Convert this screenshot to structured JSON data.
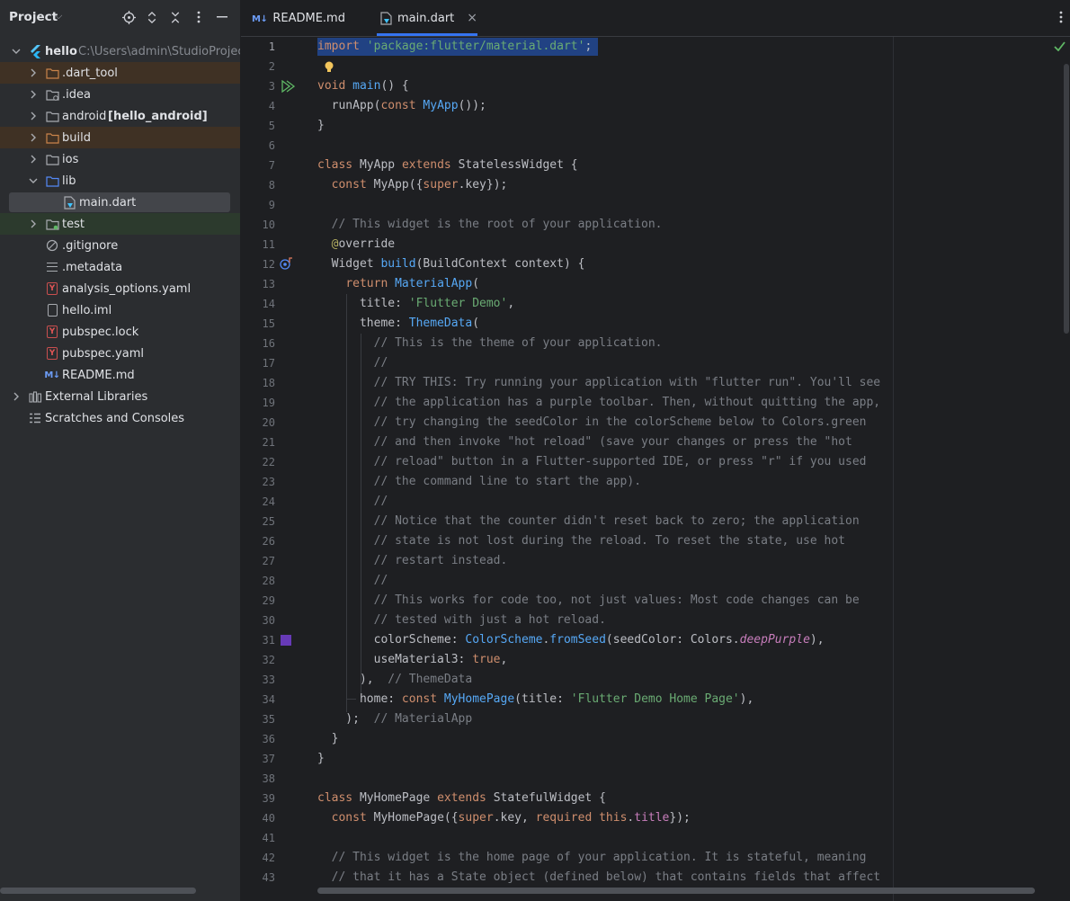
{
  "project_panel": {
    "title": "Project",
    "header_icons": [
      "locate-icon",
      "expand-all-icon",
      "collapse-all-icon",
      "more-icon",
      "minimize-icon"
    ],
    "tree": [
      {
        "name": "hello",
        "hint": "C:\\Users\\admin\\StudioProjec",
        "kind": "module",
        "depth": 0,
        "expanded": true
      },
      {
        "name": ".dart_tool",
        "kind": "folder",
        "depth": 1,
        "excluded": true
      },
      {
        "name": ".idea",
        "kind": "folder",
        "depth": 1
      },
      {
        "name": "android",
        "bold_suffix": "[hello_android]",
        "kind": "folder",
        "depth": 1
      },
      {
        "name": "build",
        "kind": "folder",
        "depth": 1,
        "excluded": true
      },
      {
        "name": "ios",
        "kind": "folder",
        "depth": 1
      },
      {
        "name": "lib",
        "kind": "folder-source",
        "depth": 1,
        "expanded": true
      },
      {
        "name": "main.dart",
        "kind": "dart-file",
        "depth": 2,
        "selected": true
      },
      {
        "name": "test",
        "kind": "folder-test",
        "depth": 1
      },
      {
        "name": ".gitignore",
        "kind": "ignore-file",
        "depth": 1
      },
      {
        "name": ".metadata",
        "kind": "text-file",
        "depth": 1
      },
      {
        "name": "analysis_options.yaml",
        "kind": "yaml-file",
        "depth": 1
      },
      {
        "name": "hello.iml",
        "kind": "iml-file",
        "depth": 1
      },
      {
        "name": "pubspec.lock",
        "kind": "yaml-file",
        "depth": 1
      },
      {
        "name": "pubspec.yaml",
        "kind": "yaml-file",
        "depth": 1
      },
      {
        "name": "README.md",
        "kind": "md-file",
        "depth": 1
      },
      {
        "name": "External Libraries",
        "kind": "libraries",
        "depth": 0
      },
      {
        "name": "Scratches and Consoles",
        "kind": "scratches",
        "depth": 0
      }
    ]
  },
  "tabs": [
    {
      "label": "README.md",
      "icon": "markdown-icon",
      "active": false
    },
    {
      "label": "main.dart",
      "icon": "dart-file-icon",
      "active": true,
      "close": "×"
    }
  ],
  "editor": {
    "line_numbers": [
      "1",
      "2",
      "3",
      "4",
      "5",
      "6",
      "7",
      "8",
      "9",
      "10",
      "11",
      "12",
      "13",
      "14",
      "15",
      "16",
      "17",
      "18",
      "19",
      "20",
      "21",
      "22",
      "23",
      "24",
      "25",
      "26",
      "27",
      "28",
      "29",
      "30",
      "31",
      "32",
      "33",
      "34",
      "35",
      "36",
      "37",
      "38",
      "39",
      "40",
      "41",
      "42",
      "43"
    ],
    "lines": [
      [
        [
          "kw",
          "import "
        ],
        [
          "str",
          "'package:flutter/material.dart'"
        ],
        [
          "",
          "; "
        ]
      ],
      [],
      [
        [
          "kw",
          "void "
        ],
        [
          "fn",
          "main"
        ],
        [
          "",
          "() {"
        ]
      ],
      [
        [
          "",
          "  runApp("
        ],
        [
          "kw",
          "const "
        ],
        [
          "cls",
          "MyApp"
        ],
        [
          "",
          "());"
        ]
      ],
      [
        [
          "",
          "}"
        ]
      ],
      [],
      [
        [
          "kw",
          "class "
        ],
        [
          "",
          "MyApp "
        ],
        [
          "kw",
          "extends "
        ],
        [
          "",
          "StatelessWidget {"
        ]
      ],
      [
        [
          "",
          "  "
        ],
        [
          "kw",
          "const "
        ],
        [
          "",
          "MyApp({"
        ],
        [
          "kw",
          "super"
        ],
        [
          "",
          ".key});"
        ]
      ],
      [],
      [
        [
          "cm",
          "  // This widget is the root of your application."
        ]
      ],
      [
        [
          "ann",
          "  @"
        ],
        [
          "",
          "override"
        ]
      ],
      [
        [
          "",
          "  Widget "
        ],
        [
          "fn",
          "build"
        ],
        [
          "",
          "(BuildContext context) {"
        ]
      ],
      [
        [
          "",
          "    "
        ],
        [
          "kw",
          "return "
        ],
        [
          "cls",
          "MaterialApp"
        ],
        [
          "",
          "("
        ]
      ],
      [
        [
          "",
          "      title: "
        ],
        [
          "str",
          "'Flutter Demo'"
        ],
        [
          "",
          ","
        ]
      ],
      [
        [
          "",
          "      theme: "
        ],
        [
          "cls",
          "ThemeData"
        ],
        [
          "",
          "("
        ]
      ],
      [
        [
          "cm",
          "        // This is the theme of your application."
        ]
      ],
      [
        [
          "cm",
          "        //"
        ]
      ],
      [
        [
          "cm",
          "        // TRY THIS: Try running your application with \"flutter run\". You'll see"
        ]
      ],
      [
        [
          "cm",
          "        // the application has a purple toolbar. Then, without quitting the app,"
        ]
      ],
      [
        [
          "cm",
          "        // try changing the seedColor in the colorScheme below to Colors.green"
        ]
      ],
      [
        [
          "cm",
          "        // and then invoke \"hot reload\" (save your changes or press the \"hot"
        ]
      ],
      [
        [
          "cm",
          "        // reload\" button in a Flutter-supported IDE, or press \"r\" if you used"
        ]
      ],
      [
        [
          "cm",
          "        // the command line to start the app)."
        ]
      ],
      [
        [
          "cm",
          "        //"
        ]
      ],
      [
        [
          "cm",
          "        // Notice that the counter didn't reset back to zero; the application"
        ]
      ],
      [
        [
          "cm",
          "        // state is not lost during the reload. To reset the state, use hot"
        ]
      ],
      [
        [
          "cm",
          "        // restart instead."
        ]
      ],
      [
        [
          "cm",
          "        //"
        ]
      ],
      [
        [
          "cm",
          "        // This works for code too, not just values: Most code changes can be"
        ]
      ],
      [
        [
          "cm",
          "        // tested with just a hot reload."
        ]
      ],
      [
        [
          "",
          "        colorScheme: "
        ],
        [
          "cls",
          "ColorScheme"
        ],
        [
          "",
          "."
        ],
        [
          "fn",
          "fromSeed"
        ],
        [
          "",
          "(seedColor: Colors."
        ],
        [
          "it",
          "deepPurple"
        ],
        [
          "",
          "),"
        ]
      ],
      [
        [
          "",
          "        useMaterial3: "
        ],
        [
          "kw",
          "true"
        ],
        [
          "",
          ","
        ]
      ],
      [
        [
          "",
          "      ),  "
        ],
        [
          "cm",
          "// ThemeData"
        ]
      ],
      [
        [
          "",
          "      home: "
        ],
        [
          "kw",
          "const "
        ],
        [
          "cls",
          "MyHomePage"
        ],
        [
          "",
          "(title: "
        ],
        [
          "str",
          "'Flutter Demo Home Page'"
        ],
        [
          "",
          "),"
        ]
      ],
      [
        [
          "",
          "    );  "
        ],
        [
          "cm",
          "// MaterialApp"
        ]
      ],
      [
        [
          "",
          "  }"
        ]
      ],
      [
        [
          "",
          "}"
        ]
      ],
      [],
      [
        [
          "kw",
          "class "
        ],
        [
          "",
          "MyHomePage "
        ],
        [
          "kw",
          "extends "
        ],
        [
          "",
          "StatefulWidget {"
        ]
      ],
      [
        [
          "",
          "  "
        ],
        [
          "kw",
          "const "
        ],
        [
          "",
          "MyHomePage({"
        ],
        [
          "kw",
          "super"
        ],
        [
          "",
          ".key, "
        ],
        [
          "kw",
          "required "
        ],
        [
          "kw",
          "this"
        ],
        [
          "",
          "."
        ],
        [
          "fld",
          "title"
        ],
        [
          "",
          "});"
        ]
      ],
      [],
      [
        [
          "cm",
          "  // This widget is the home page of your application. It is stateful, meaning"
        ]
      ],
      [
        [
          "cm",
          "  // that it has a State object (defined below) that contains fields that affect"
        ]
      ]
    ],
    "gutter_icons": [
      {
        "line": 2,
        "icon": "intention-bulb-icon"
      },
      {
        "line": 3,
        "icon": "run-icon"
      },
      {
        "line": 12,
        "icon": "override-method-icon"
      },
      {
        "line": 31,
        "icon": "color-swatch-icon",
        "color": "#673ab7"
      }
    ],
    "status_icon": "no-problems-check-icon"
  }
}
